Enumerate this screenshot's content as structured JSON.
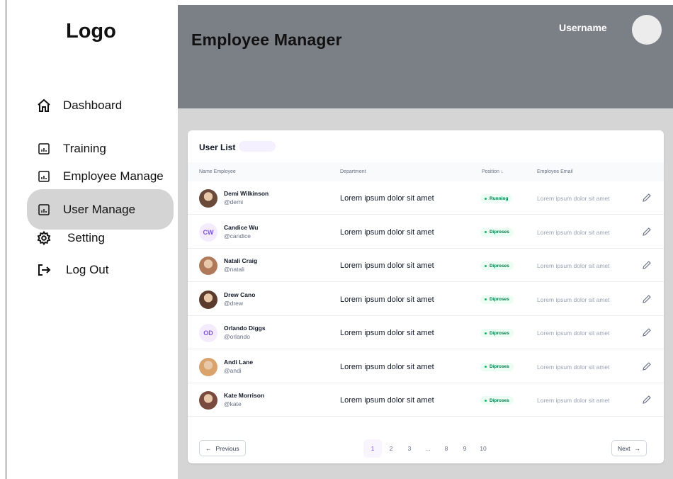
{
  "sidebar": {
    "logo": "Logo",
    "items": [
      {
        "label": "Dashboard",
        "icon": "home-icon"
      },
      {
        "label": "Training",
        "icon": "chart-doc-icon"
      },
      {
        "label": "Employee Manage",
        "icon": "chart-doc-icon"
      },
      {
        "label": "User Manage",
        "icon": "chart-doc-icon",
        "active": true
      },
      {
        "label": "Setting",
        "icon": "gear-icon"
      },
      {
        "label": "Log Out",
        "icon": "logout-icon"
      }
    ]
  },
  "header": {
    "title": "Employee Manager",
    "username": "Username"
  },
  "table": {
    "title": "User List",
    "columns": [
      "Name Employee",
      "Department",
      "Position",
      "Employee Email"
    ],
    "rows": [
      {
        "name": "Demi Wilkinson",
        "handle": "@demi",
        "department": "Lorem ipsum dolor sit amet",
        "position": "Running",
        "email": "Lorem ipsum dolor sit amet"
      },
      {
        "name": "Candice Wu",
        "handle": "@candice",
        "initials": "CW",
        "department": "Lorem ipsum dolor sit amet",
        "position": "Diproses",
        "email": "Lorem ipsum dolor sit amet"
      },
      {
        "name": "Natali Craig",
        "handle": "@natali",
        "department": "Lorem ipsum dolor sit amet",
        "position": "Diproses",
        "email": "Lorem ipsum dolor sit amet"
      },
      {
        "name": "Drew Cano",
        "handle": "@drew",
        "department": "Lorem ipsum dolor sit amet",
        "position": "Diproses",
        "email": "Lorem ipsum dolor sit amet"
      },
      {
        "name": "Orlando Diggs",
        "handle": "@orlando",
        "initials": "OD",
        "department": "Lorem ipsum dolor sit amet",
        "position": "Diproses",
        "email": "Lorem ipsum dolor sit amet"
      },
      {
        "name": "Andi Lane",
        "handle": "@andi",
        "department": "Lorem ipsum dolor sit amet",
        "position": "Diproses",
        "email": "Lorem ipsum dolor sit amet"
      },
      {
        "name": "Kate Morrison",
        "handle": "@kate",
        "department": "Lorem ipsum dolor sit amet",
        "position": "Diproses",
        "email": "Lorem ipsum dolor sit amet"
      }
    ]
  },
  "pagination": {
    "previous": "Previous",
    "next": "Next",
    "pages": [
      "1",
      "2",
      "3",
      "...",
      "8",
      "9",
      "10"
    ],
    "current": "1"
  },
  "colors": {
    "header_bg": "#7b7f86",
    "content_bg": "#d5d5d5",
    "active_nav_bg": "#d4d4d4",
    "badge_green": "#027a48",
    "accent_purple": "#7f56d9"
  }
}
